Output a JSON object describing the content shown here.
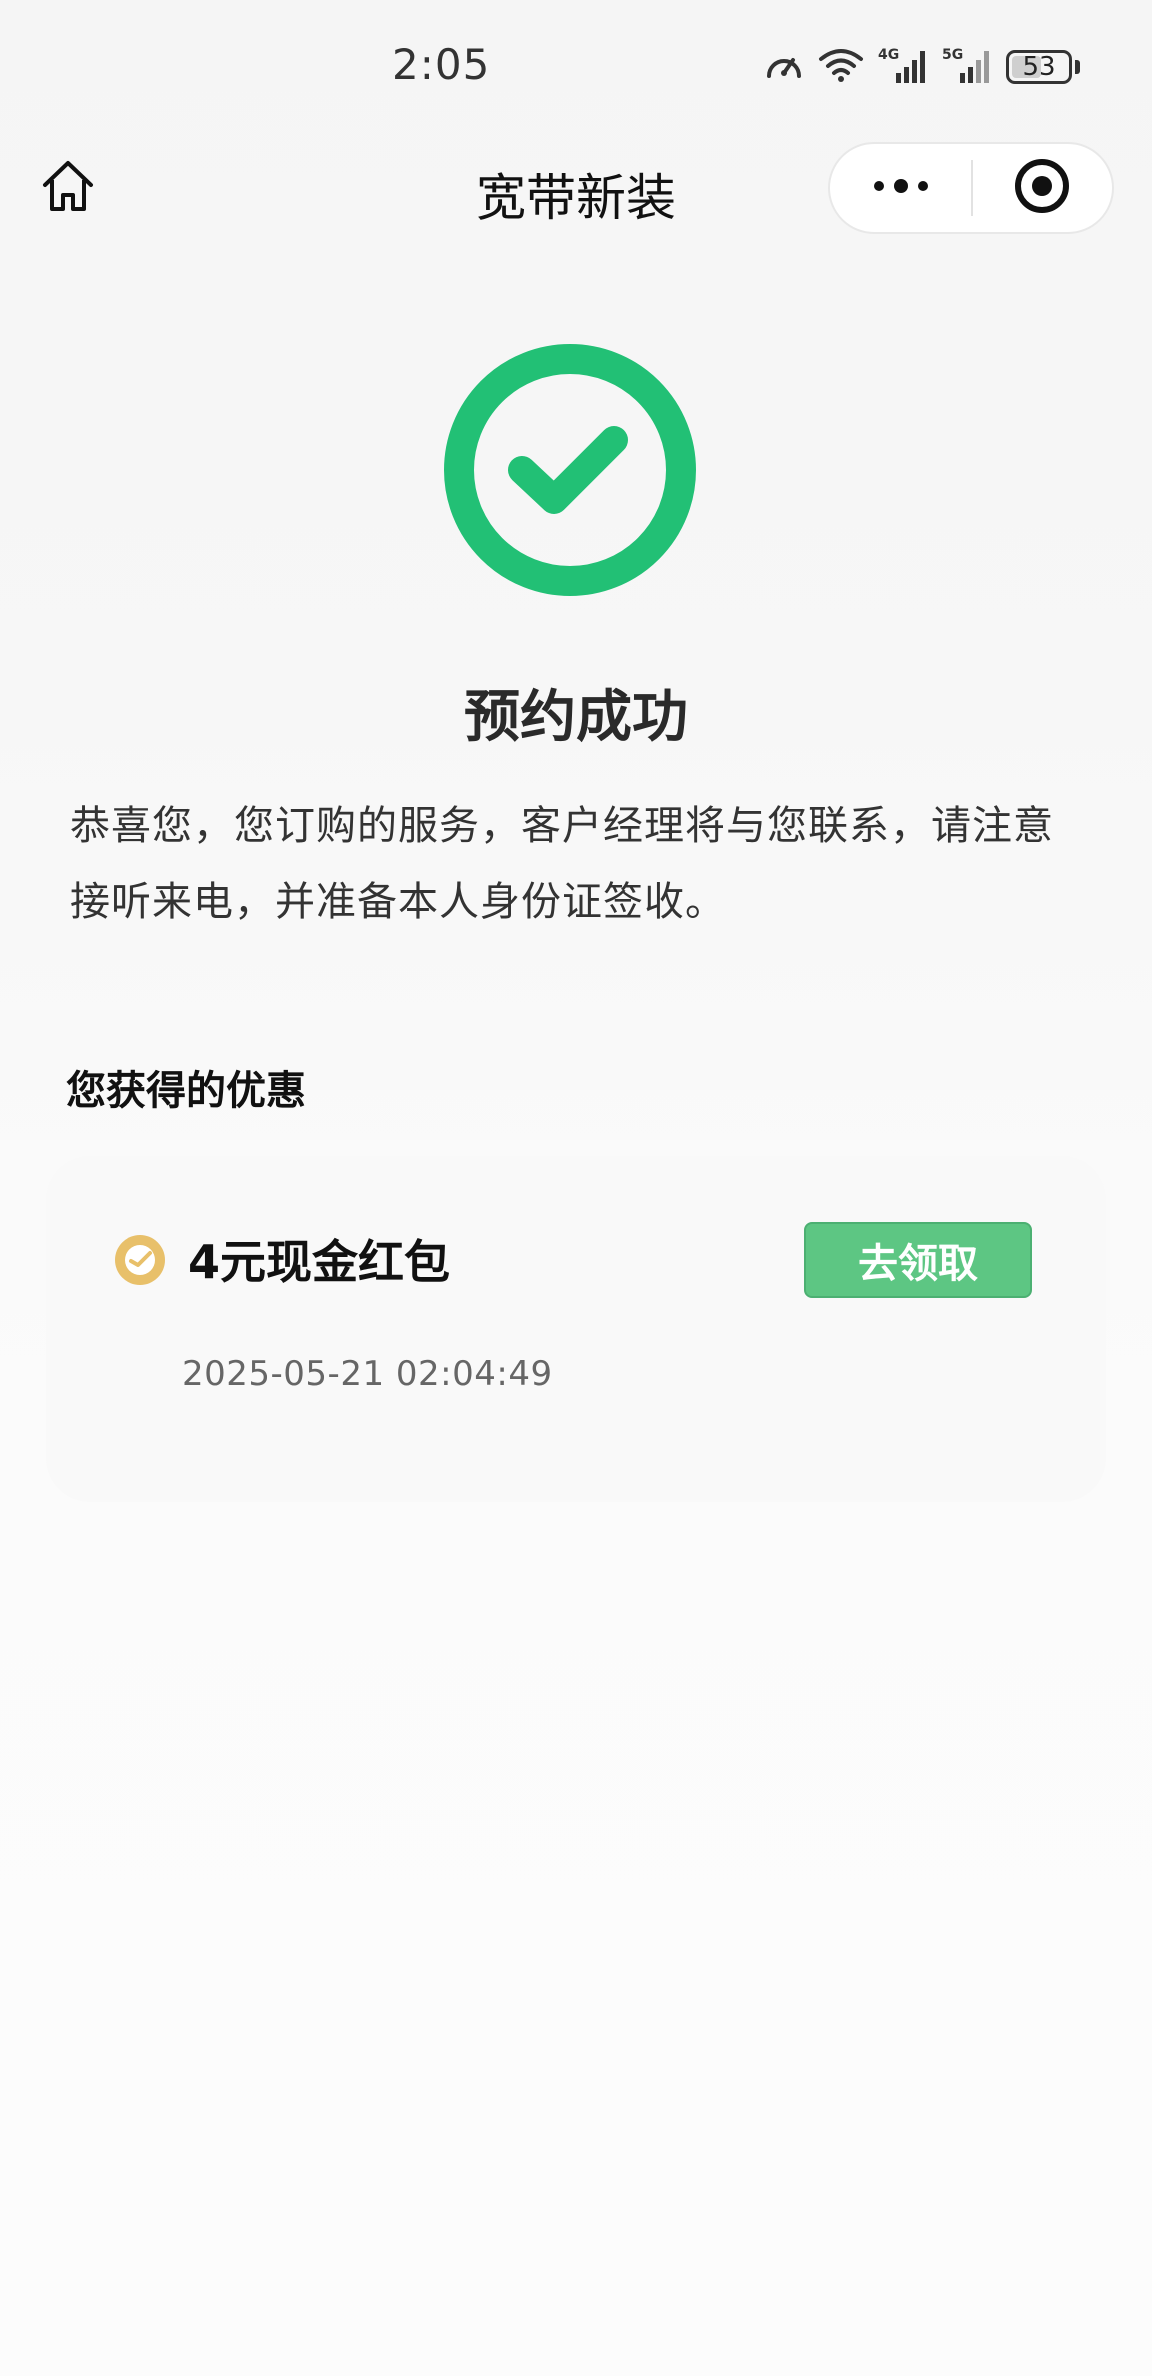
{
  "status_bar": {
    "time": "2:05",
    "battery_level": "53",
    "icons": [
      "speed-icon",
      "wifi-icon",
      "4g-signal-icon",
      "5g-signal-icon",
      "battery-icon"
    ]
  },
  "nav": {
    "title": "宽带新装",
    "home_icon": "home-icon",
    "more_icon": "more-dots-icon",
    "close_icon": "target-close-icon"
  },
  "success": {
    "icon": "check-circle-icon",
    "title": "预约成功",
    "message": "恭喜您，您订购的服务，客户经理将与您联系，请注意接听来电，并准备本人身份证签收。"
  },
  "benefits": {
    "section_title": "您获得的优惠",
    "items": [
      {
        "icon": "coupon-icon",
        "name": "4元现金红包",
        "action_label": "去领取",
        "time": "2025-05-21 02:04:49"
      }
    ]
  },
  "colors": {
    "accent_green": "#22c075",
    "button_green": "#5dc683",
    "coupon_gold": "#e8c06a"
  }
}
